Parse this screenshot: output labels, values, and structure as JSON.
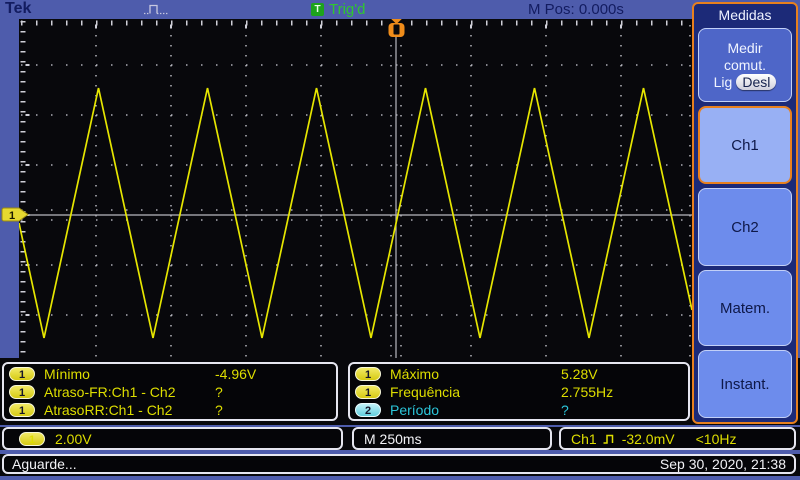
{
  "topbar": {
    "logo": "Tek",
    "acquisition_icon": "pulse-waveform-icon",
    "trigger_badge": "T",
    "trigger_status": "Trig'd",
    "m_pos": "M Pos: 0.000s"
  },
  "sidebar": {
    "title": "Medidas",
    "measure_all_button": {
      "line1": "Medir",
      "line2": "comut.",
      "on_label": "Lig",
      "off_label": "Desl"
    },
    "buttons": [
      {
        "label": "Ch1",
        "selected": true
      },
      {
        "label": "Ch2",
        "selected": false
      },
      {
        "label": "Matem.",
        "selected": false
      },
      {
        "label": "Instant.",
        "selected": false
      }
    ]
  },
  "screen": {
    "channel_marker": "1",
    "trigger_marker_icon": "trigger-position-arrow"
  },
  "measurements": {
    "left": [
      {
        "channel": "1",
        "label": "Mínimo",
        "value": "-4.96V"
      },
      {
        "channel": "1",
        "label": "Atraso-FR:Ch1 - Ch2",
        "value": "?"
      },
      {
        "channel": "1",
        "label": "AtrasoRR:Ch1 - Ch2",
        "value": "?"
      }
    ],
    "right": [
      {
        "channel": "1",
        "label": "Máximo",
        "value": "5.28V"
      },
      {
        "channel": "1",
        "label": "Frequência",
        "value": "2.755Hz"
      },
      {
        "channel": "2",
        "label": "Período",
        "value": "?"
      }
    ]
  },
  "statusbar": {
    "ch1_badge": "1",
    "ch1_scale": "2.00V",
    "timebase": "M 250ms",
    "trigger_source": "Ch1",
    "trigger_icon": "pulse-edge-icon",
    "trigger_level": "-32.0mV",
    "trigger_coupling": "<10Hz",
    "message": "Aguarde...",
    "datetime": "Sep 30, 2020, 21:38"
  },
  "colors": {
    "background_blue": "#4e5cac",
    "screen_black": "#08080c",
    "trace_yellow": "#e6e600",
    "cyan": "#2cc6da",
    "orange_accent": "#e8801e",
    "trigd_green": "#2fc82f",
    "panel_navy": "#1c2a78"
  }
}
